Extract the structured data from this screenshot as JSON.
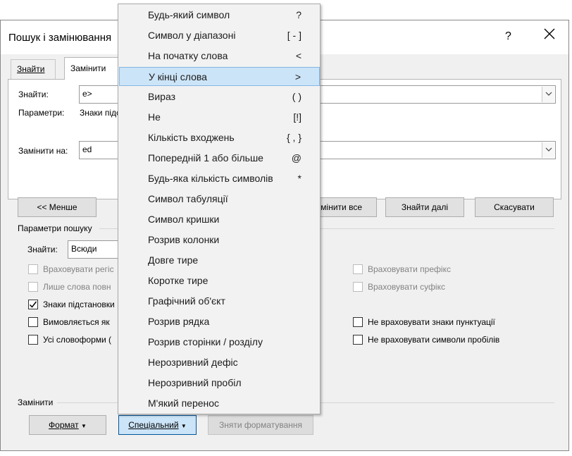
{
  "dialog": {
    "title": "Пошук і замінювання",
    "help": "?",
    "tabs": [
      {
        "label": "Знайти"
      },
      {
        "label": "Замінити"
      }
    ],
    "find_label": "Знайти:",
    "find_value": "e>",
    "params_label": "Параметри:",
    "params_value": "Знаки підс",
    "replace_label": "Замінити на:",
    "replace_value": "ed",
    "less_button": "<< Менше",
    "replace_all_button": "мінити все",
    "find_next_button": "Знайти далі",
    "cancel_button": "Скасувати",
    "search_options_title": "Параметри пошуку",
    "search_in_label": "Знайти:",
    "search_in_value": "Всюди",
    "options_left": [
      {
        "label": "Враховувати регіс",
        "checked": false,
        "disabled": true
      },
      {
        "label": "Лише слова повн",
        "checked": false,
        "disabled": true
      },
      {
        "label": "Знаки підстановки",
        "checked": true,
        "disabled": false
      },
      {
        "label": "Вимовляється як",
        "checked": false,
        "disabled": false
      },
      {
        "label": "Усі словоформи (",
        "checked": false,
        "disabled": false
      }
    ],
    "options_right": [
      {
        "label": "Враховувати префікс",
        "checked": false,
        "disabled": true
      },
      {
        "label": "Враховувати суфікс",
        "checked": false,
        "disabled": true
      },
      {
        "label": "Не враховувати знаки пунктуації",
        "checked": false,
        "disabled": false
      },
      {
        "label": "Не враховувати символи пробілів",
        "checked": false,
        "disabled": false
      }
    ],
    "replace_section_title": "Замінити",
    "format_button": "Формат",
    "special_button": "Спеціальний",
    "no_formatting_button": "Зняти форматування"
  },
  "special_menu": {
    "items": [
      {
        "label": "Будь-який символ",
        "key": "?"
      },
      {
        "label": "Символ у діапазоні",
        "key": "[ - ]"
      },
      {
        "label": "На початку слова",
        "key": "<"
      },
      {
        "label": "У кінці слова",
        "key": ">"
      },
      {
        "label": "Вираз",
        "key": "( )"
      },
      {
        "label": "Не",
        "key": "[!]"
      },
      {
        "label": "Кількість входжень",
        "key": "{ , }"
      },
      {
        "label": "Попередній 1 або більше",
        "key": "@"
      },
      {
        "label": "Будь-яка кількість символів",
        "key": "*"
      },
      {
        "label": "Символ табуляції",
        "key": ""
      },
      {
        "label": "Символ кришки",
        "key": ""
      },
      {
        "label": "Розрив колонки",
        "key": ""
      },
      {
        "label": "Довге тире",
        "key": ""
      },
      {
        "label": "Коротке тире",
        "key": ""
      },
      {
        "label": "Графічний об'єкт",
        "key": ""
      },
      {
        "label": "Розрив рядка",
        "key": ""
      },
      {
        "label": "Розрив сторінки / розділу",
        "key": ""
      },
      {
        "label": "Нерозривний дефіс",
        "key": ""
      },
      {
        "label": "Нерозривний пробіл",
        "key": ""
      },
      {
        "label": "М'який перенос",
        "key": ""
      }
    ],
    "highlighted_index": 3
  },
  "colors": {
    "highlight_bg": "#cce4f7",
    "highlight_border": "#84b6e2",
    "dialog_bg": "#f0f0f0"
  }
}
